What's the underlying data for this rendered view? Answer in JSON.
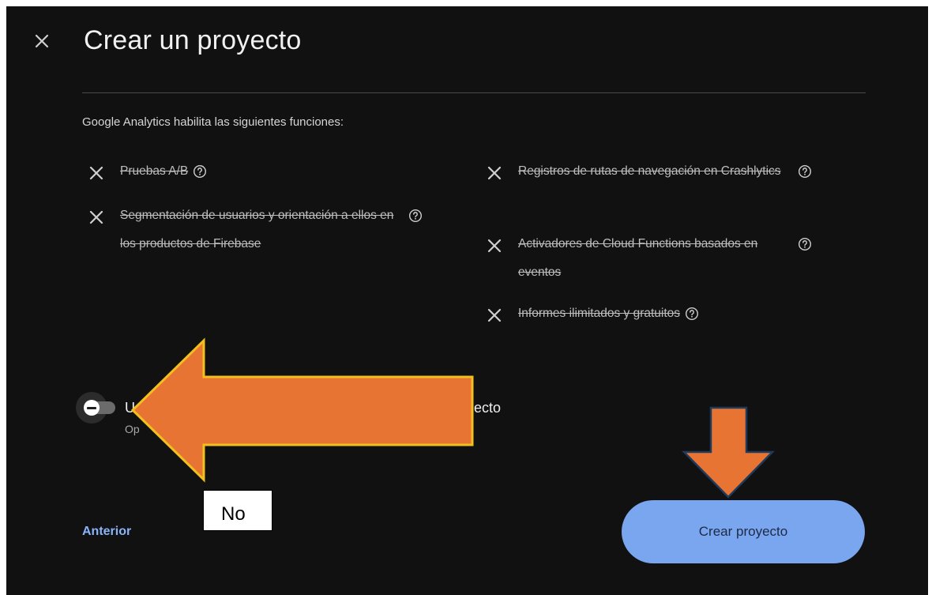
{
  "dialog": {
    "title": "Crear un proyecto",
    "intro": "Google Analytics habilita las siguientes funciones:"
  },
  "features": {
    "left": [
      {
        "label": "Pruebas A/B"
      },
      {
        "label": "Segmentación de usuarios y orientación a ellos en los productos de Firebase"
      }
    ],
    "right": [
      {
        "label": "Registros de rutas de navegación en Crashlytics"
      },
      {
        "label": "Activadores de Cloud Functions basados en eventos"
      },
      {
        "label": "Informes ilimitados y gratuitos"
      }
    ]
  },
  "toggle": {
    "title_visible_left": "U",
    "title_visible_right": "ecto",
    "subtitle_visible": "Op",
    "state": "off"
  },
  "footer": {
    "back_label": "Anterior",
    "create_label": "Crear proyecto"
  },
  "annotations": {
    "no_label": "No",
    "arrow_color": "#e87433",
    "arrow_outline": "#f2c01e"
  },
  "colors": {
    "background": "#111111",
    "accent": "#8ab4f8",
    "button": "#7aa6f0"
  }
}
